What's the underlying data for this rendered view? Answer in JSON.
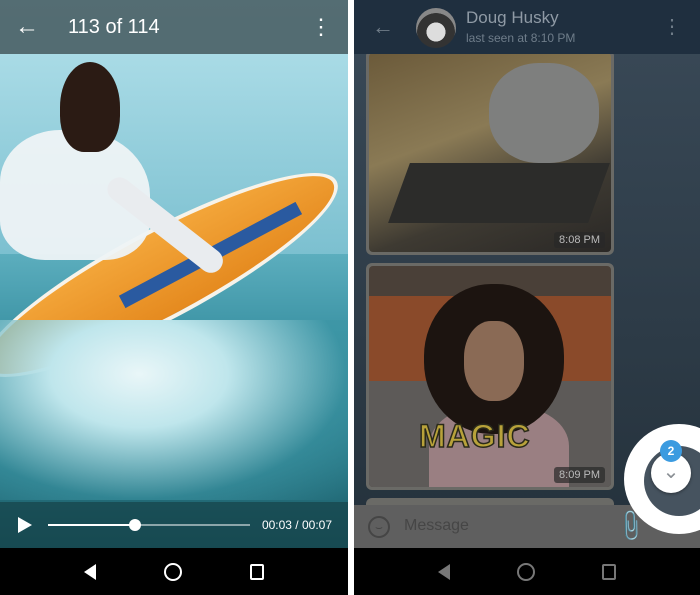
{
  "viewer": {
    "title": "113 of 114",
    "current_time": "00:03",
    "total_time": "00:07",
    "time_label": "00:03 / 00:07",
    "progress": 0.43
  },
  "chat": {
    "contact_name": "Doug Husky",
    "status": "last seen at 8:10 PM",
    "messages": [
      {
        "type": "gif",
        "time": "8:08 PM"
      },
      {
        "type": "gif",
        "caption": "MAGIC",
        "time": "8:09 PM"
      }
    ],
    "input_placeholder": "Message",
    "unread_count": "2"
  },
  "colors": {
    "header": "#1f2f3f",
    "badge": "#3b9be0"
  }
}
